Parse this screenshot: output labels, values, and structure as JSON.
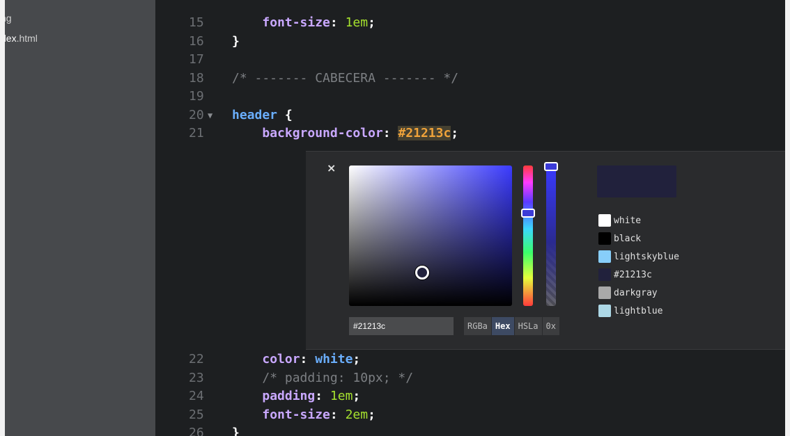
{
  "sidebar": {
    "items": [
      {
        "prefix": "ng",
        "bold": "",
        "suffix": ""
      },
      {
        "prefix": "",
        "bold": "dex",
        "suffix": ".html"
      }
    ]
  },
  "editor": {
    "lines_top": [
      {
        "num": "15",
        "parts": [
          {
            "t": "    ",
            "c": ""
          },
          {
            "t": "font-size",
            "c": "prop"
          },
          {
            "t": ": ",
            "c": "punct"
          },
          {
            "t": "1em",
            "c": "val"
          },
          {
            "t": ";",
            "c": "punct"
          }
        ]
      },
      {
        "num": "16",
        "parts": [
          {
            "t": "}",
            "c": "punct"
          }
        ]
      },
      {
        "num": "17",
        "parts": []
      },
      {
        "num": "18",
        "parts": [
          {
            "t": "/* ------- CABECERA ------- */",
            "c": "comment"
          }
        ]
      },
      {
        "num": "19",
        "parts": []
      },
      {
        "num": "20",
        "fold": "▼",
        "parts": [
          {
            "t": "header",
            "c": "tag"
          },
          {
            "t": " {",
            "c": "punct"
          }
        ]
      },
      {
        "num": "21",
        "parts": [
          {
            "t": "    ",
            "c": ""
          },
          {
            "t": "background-color",
            "c": "prop"
          },
          {
            "t": ": ",
            "c": "punct"
          },
          {
            "t": "#21213c",
            "c": "hex-hl"
          },
          {
            "t": ";",
            "c": "punct"
          }
        ]
      }
    ],
    "lines_bottom": [
      {
        "num": "22",
        "parts": [
          {
            "t": "    ",
            "c": ""
          },
          {
            "t": "color",
            "c": "prop"
          },
          {
            "t": ": ",
            "c": "punct"
          },
          {
            "t": "white",
            "c": "val-white"
          },
          {
            "t": ";",
            "c": "punct"
          }
        ]
      },
      {
        "num": "23",
        "parts": [
          {
            "t": "    ",
            "c": ""
          },
          {
            "t": "/* padding: 10px; */",
            "c": "comment"
          }
        ]
      },
      {
        "num": "24",
        "parts": [
          {
            "t": "    ",
            "c": ""
          },
          {
            "t": "padding",
            "c": "prop"
          },
          {
            "t": ": ",
            "c": "punct"
          },
          {
            "t": "1em",
            "c": "val"
          },
          {
            "t": ";",
            "c": "punct"
          }
        ]
      },
      {
        "num": "25",
        "parts": [
          {
            "t": "    ",
            "c": ""
          },
          {
            "t": "font-size",
            "c": "prop"
          },
          {
            "t": ": ",
            "c": "punct"
          },
          {
            "t": "2em",
            "c": "val"
          },
          {
            "t": ";",
            "c": "punct"
          }
        ]
      },
      {
        "num": "26",
        "parts": [
          {
            "t": "}",
            "c": "punct"
          }
        ]
      }
    ]
  },
  "picker": {
    "close_icon": "×",
    "hex_value": "#21213c",
    "current_color": "#21213c",
    "modes": [
      {
        "label": "RGBa",
        "active": false
      },
      {
        "label": "Hex",
        "active": true
      },
      {
        "label": "HSLa",
        "active": false
      },
      {
        "label": "0x",
        "active": false
      }
    ],
    "swatches": [
      {
        "name": "white",
        "color": "#ffffff"
      },
      {
        "name": "black",
        "color": "#000000"
      },
      {
        "name": "lightskyblue",
        "color": "#87cefa"
      },
      {
        "name": "#21213c",
        "color": "#21213c"
      },
      {
        "name": "darkgray",
        "color": "#a9a9a9"
      },
      {
        "name": "lightblue",
        "color": "#add8e6"
      }
    ]
  }
}
